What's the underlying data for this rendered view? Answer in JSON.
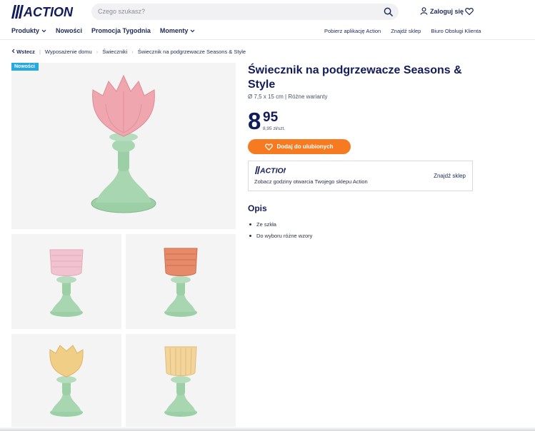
{
  "colors": {
    "brand": "#121b5b",
    "accent": "#f57a20",
    "badge": "#27a8e0"
  },
  "header": {
    "logo_text": "ACTION",
    "search_placeholder": "Czego szukasz?",
    "login_label": "Zaloguj się"
  },
  "nav": {
    "left": [
      {
        "label": "Produkty",
        "has_dropdown": true
      },
      {
        "label": "Nowości",
        "has_dropdown": false
      },
      {
        "label": "Promocja Tygodnia",
        "has_dropdown": false
      },
      {
        "label": "Momenty",
        "has_dropdown": true
      }
    ],
    "right": [
      "Pobierz aplikację Action",
      "Znajdź sklep",
      "Biuro Obsługi Klienta"
    ]
  },
  "breadcrumb": {
    "back": "Wstecz",
    "items": [
      "Wyposażenie domu",
      "Świeczniki",
      "Świecznik na podgrzewacze Seasons & Style"
    ]
  },
  "gallery": {
    "badge": "Nowości",
    "images": [
      {
        "name": "pink-tulip",
        "cup": "#efa6ae",
        "stem": "#9dcfa7"
      },
      {
        "name": "pink-diamond",
        "cup": "#f1c2cf",
        "stem": "#9dcfa7"
      },
      {
        "name": "orange-diamond",
        "cup": "#e78a69",
        "stem": "#9dcfa7"
      },
      {
        "name": "yellow-tulip",
        "cup": "#f1ce86",
        "stem": "#9dcfa7"
      },
      {
        "name": "yellow-ribbed",
        "cup": "#f3d49a",
        "stem": "#9dcfa7"
      }
    ]
  },
  "product": {
    "title": "Świecznik na podgrzewacze Seasons & Style",
    "subtitle": "Ø 7,5 x 15 cm | Różne warianty",
    "price_int": "8",
    "price_dec": "95",
    "price_unit": "8,95 zł/szt.",
    "fav_button": "Dodaj do ulubionych"
  },
  "store": {
    "logo_text": "ACTION",
    "text": "Zobacz godziny otwarcia Twojego sklepu Action",
    "link": "Znajdź sklep"
  },
  "description": {
    "title": "Opis",
    "bullets": [
      "Ze szkła",
      "Do wyboru różne wzory"
    ]
  }
}
